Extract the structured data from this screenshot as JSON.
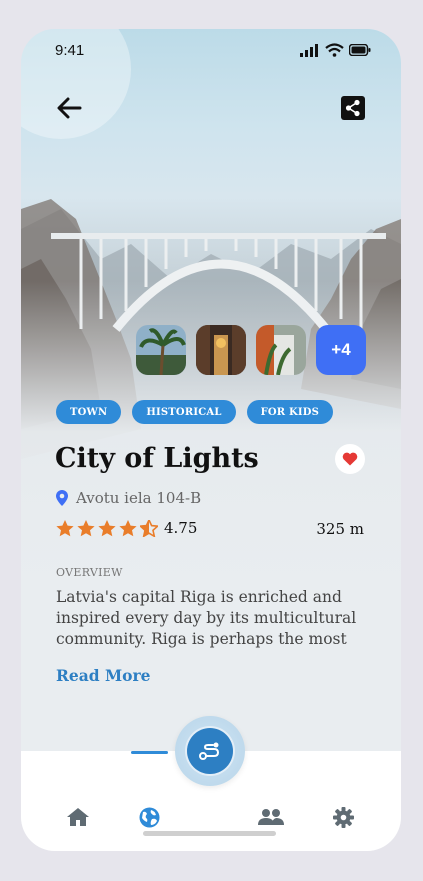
{
  "status_bar": {
    "time": "9:41"
  },
  "gallery": {
    "more_label": "+4"
  },
  "tags": [
    "TOWN",
    "HISTORICAL",
    "FOR KIDS"
  ],
  "place": {
    "title": "City of Lights",
    "address": "Avotu iela 104-B",
    "rating": "4.75",
    "rating_value": 4.75,
    "distance": "325 m",
    "overview_label": "OVERVIEW",
    "overview_text": "Latvia's capital Riga is enriched and inspired every day by its multicultural community. Riga is perhaps the most",
    "read_more": "Read More"
  },
  "icons": {
    "back": "arrow-left-icon",
    "share": "share-icon",
    "favorite": "heart-icon",
    "location": "map-pin-icon",
    "fab": "route-icon",
    "nav": [
      "home-icon",
      "globe-icon",
      "users-icon",
      "gear-icon"
    ]
  },
  "colors": {
    "accent": "#2f8bd8",
    "more_badge": "#3f6ff5",
    "star": "#e97d2a",
    "heart": "#e53935",
    "pin": "#3f6ff5",
    "nav_active": "#2f8bd8",
    "nav_inactive": "#5f6b73"
  }
}
